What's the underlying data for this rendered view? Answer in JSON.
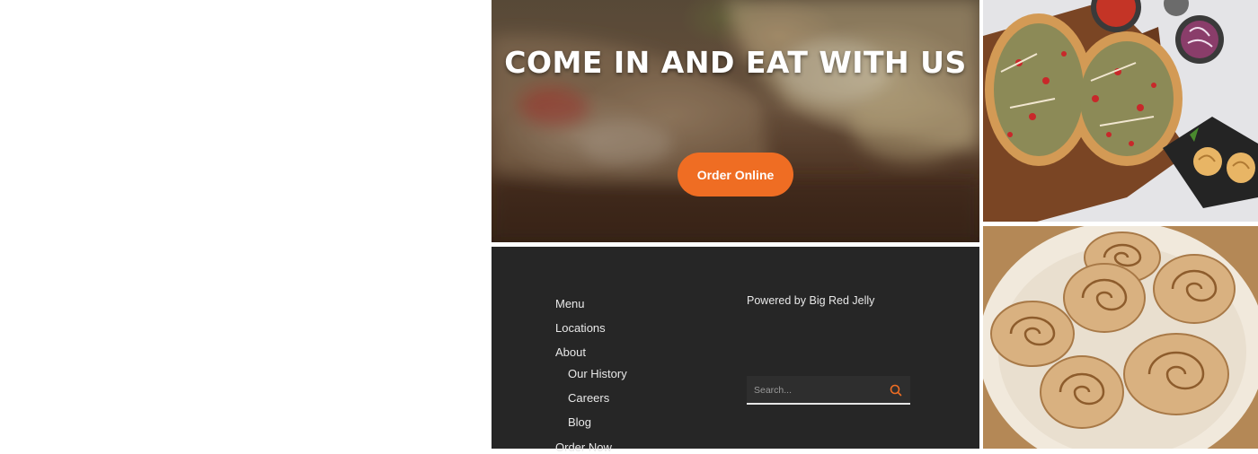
{
  "hero": {
    "title": "COME IN AND EAT WITH US",
    "order_button_label": "Order Online",
    "accent_color": "#ef6d23"
  },
  "footer": {
    "nav": [
      {
        "label": "Menu"
      },
      {
        "label": "Locations"
      },
      {
        "label": "About"
      },
      {
        "label": "Our History"
      },
      {
        "label": "Careers"
      },
      {
        "label": "Blog"
      },
      {
        "label": "Order Now"
      }
    ],
    "powered_by": "Powered by Big Red Jelly",
    "search": {
      "placeholder": "Search...",
      "icon": "search-icon"
    },
    "background_color": "#262626"
  },
  "gallery": {
    "images": [
      {
        "name": "pizza-board-photo"
      },
      {
        "name": "cinnamon-rolls-photo"
      }
    ]
  }
}
